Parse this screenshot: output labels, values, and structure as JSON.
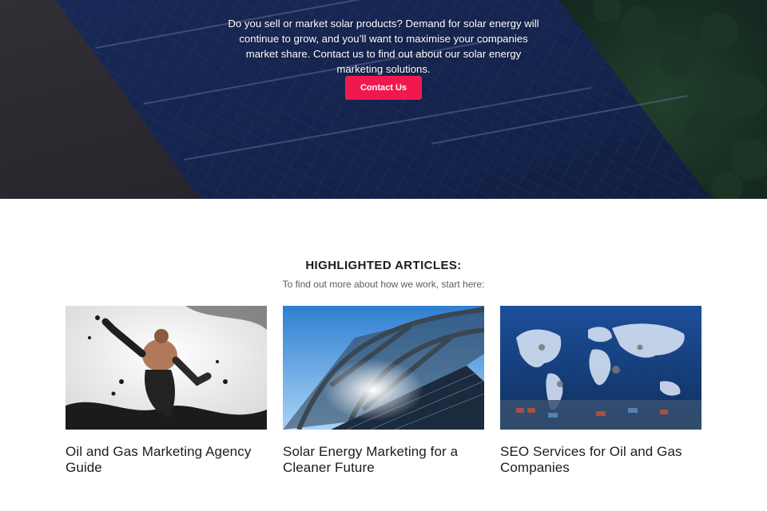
{
  "hero": {
    "description": "Do you sell or market solar products? Demand for solar energy will continue to grow, and you’ll want to maximise your companies market share. Contact us to find out about our solar energy marketing solutions.",
    "cta_label": "Contact Us",
    "accent_color": "#f0194f"
  },
  "articles_section": {
    "heading": "HIGHLIGHTED ARTICLES:",
    "subheading": "To find out more about how we work, start here:",
    "items": [
      {
        "title": "Oil and Gas Marketing Agency Guide",
        "image": "man-splashing-oil-image"
      },
      {
        "title": "Solar Energy Marketing for a Cleaner Future",
        "image": "solar-panel-canopy-image"
      },
      {
        "title": "SEO Services for Oil and Gas Companies",
        "image": "world-map-port-image"
      }
    ]
  }
}
